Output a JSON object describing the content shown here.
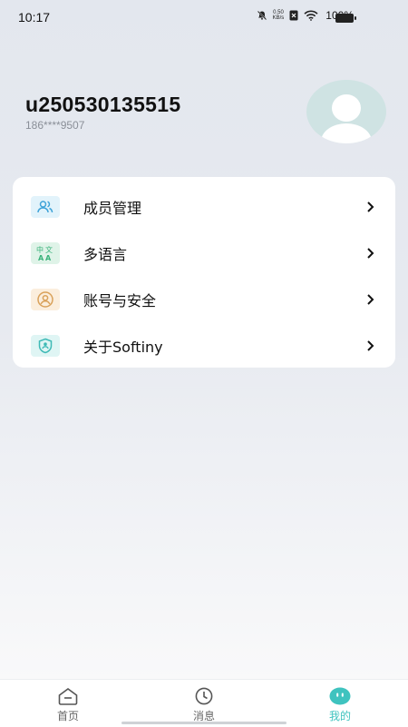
{
  "status_bar": {
    "time": "10:17",
    "net_speed_value": "0.50",
    "net_speed_unit": "KB/s",
    "battery_percent": "100%"
  },
  "profile": {
    "username": "u250530135515",
    "phone": "186****9507"
  },
  "menu": [
    {
      "label": "成员管理",
      "icon": "members-icon",
      "icon_color": "#3fa3d8",
      "icon_bg": "#e2f3fb"
    },
    {
      "label": "多语言",
      "icon": "language-icon",
      "icon_color": "#39b27a",
      "icon_bg": "#dff3e8"
    },
    {
      "label": "账号与安全",
      "icon": "account-security-icon",
      "icon_color": "#d9a15a",
      "icon_bg": "#fbeedd"
    },
    {
      "label": "关于Softiny",
      "icon": "about-icon",
      "icon_color": "#3fbab6",
      "icon_bg": "#dff5f4"
    }
  ],
  "tabs": [
    {
      "label": "首页",
      "icon": "home-icon"
    },
    {
      "label": "消息",
      "icon": "clock-icon"
    },
    {
      "label": "我的",
      "icon": "profile-face-icon",
      "active": true
    }
  ],
  "colors": {
    "accent": "#3fc3bf",
    "text_secondary": "#8a8f98"
  }
}
